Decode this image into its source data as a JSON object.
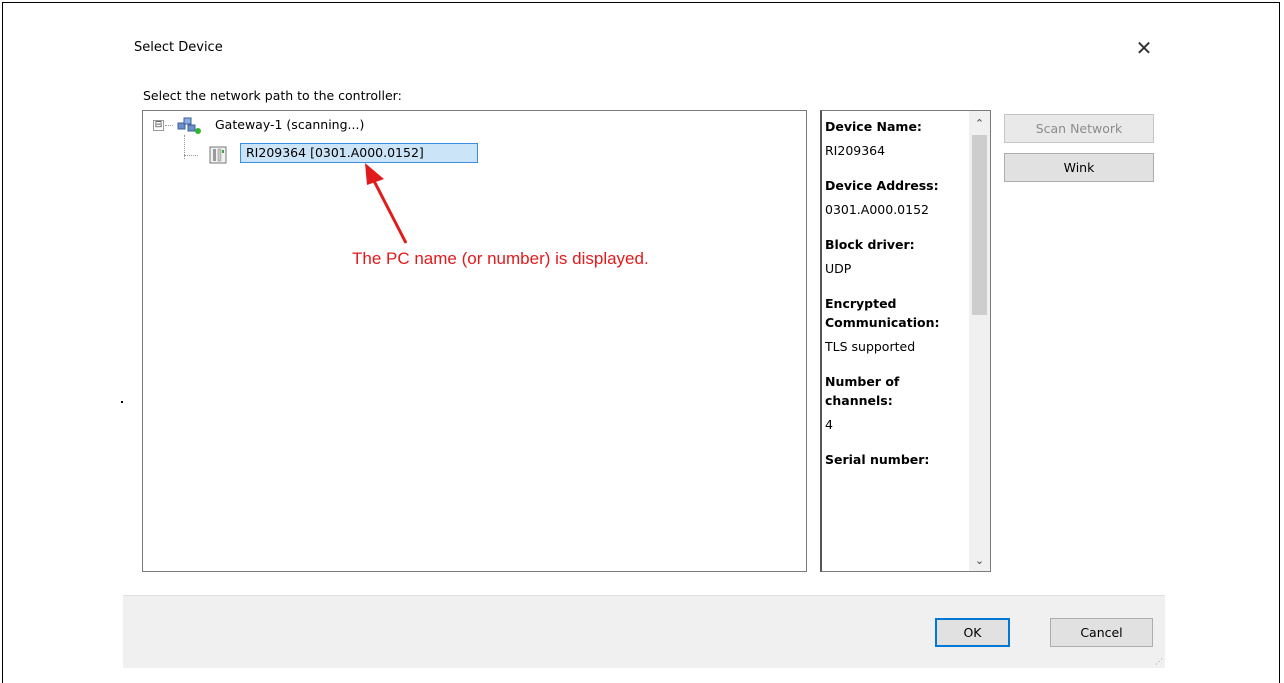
{
  "dialog": {
    "title": "Select Device",
    "close_glyph": "✕",
    "prompt": "Select the network path to the controller:"
  },
  "tree": {
    "expander_glyph": "⊟",
    "gateway": {
      "label": "Gateway-1 (scanning...)",
      "icon": "network-gateway-icon"
    },
    "device": {
      "label": "RI209364 [0301.A000.0152]",
      "icon": "controller-device-icon",
      "selected": true
    }
  },
  "annotation": {
    "text": "The PC name (or number) is displayed.",
    "color": "#e11b1b"
  },
  "details": {
    "fields": [
      {
        "label": "Device Name:",
        "value": "RI209364"
      },
      {
        "label": "Device Address:",
        "value": "0301.A000.0152"
      },
      {
        "label": "Block driver:",
        "value": "UDP"
      },
      {
        "label": "Encrypted Communication:",
        "value": "TLS supported"
      },
      {
        "label": "Number of channels:",
        "value": "4"
      },
      {
        "label": "Serial number:",
        "value": ""
      }
    ],
    "scroll_up_glyph": "⌃",
    "scroll_down_glyph": "⌄"
  },
  "buttons": {
    "scan_network": "Scan Network",
    "wink": "Wink",
    "ok": "OK",
    "cancel": "Cancel"
  },
  "colors": {
    "selection_bg": "#cce4f7",
    "selection_border": "#3a8ee6",
    "default_button_border": "#0078d7"
  }
}
